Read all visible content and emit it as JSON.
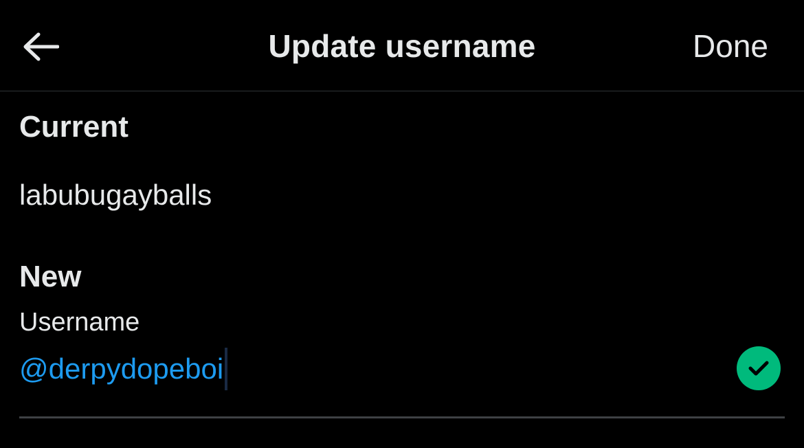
{
  "header": {
    "back_icon": "arrow-left-icon",
    "title": "Update username",
    "done_label": "Done"
  },
  "current": {
    "label": "Current",
    "value": "labubugayballs"
  },
  "new": {
    "label": "New",
    "field_label": "Username",
    "value": "@derpydopeboi",
    "status_icon": "check-circle-icon"
  },
  "colors": {
    "background": "#000000",
    "text": "#e7e9ea",
    "accent": "#1d9bf0",
    "success": "#00ba7c",
    "divider": "#2f3336"
  }
}
